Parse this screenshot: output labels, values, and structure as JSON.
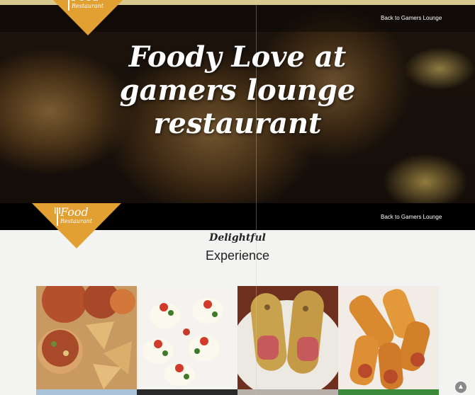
{
  "brand": {
    "name": "Food",
    "tagline": "Restaurant"
  },
  "nav": {
    "back_link": "Back to Gamers Lounge"
  },
  "hero": {
    "title": "Foody Love at gamers lounge restaurant"
  },
  "section": {
    "script_heading": "Delightful",
    "heading": "Experience"
  },
  "gallery": {
    "items": [
      {
        "name": "pizza-photo"
      },
      {
        "name": "stuffed-eggs-photo"
      },
      {
        "name": "hotdog-wraps-photo"
      },
      {
        "name": "spring-rolls-photo"
      }
    ]
  },
  "colors": {
    "accent": "#e29f32",
    "navbar": "#000000",
    "hero_text": "#ffffff"
  },
  "icons": {
    "logo": "fork-icon",
    "scroll": "arrow-up-icon"
  }
}
